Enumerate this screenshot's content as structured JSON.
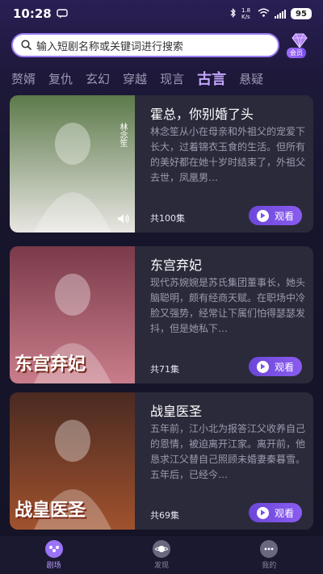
{
  "status_bar": {
    "time": "10:28",
    "network_speed": "1.8 K/s",
    "battery": "95"
  },
  "search": {
    "placeholder": "输入短剧名称或关键词进行搜索",
    "vip_label": "会员"
  },
  "tabs": [
    {
      "label": "赘婿",
      "active": false
    },
    {
      "label": "复仇",
      "active": false
    },
    {
      "label": "玄幻",
      "active": false
    },
    {
      "label": "穿越",
      "active": false
    },
    {
      "label": "现言",
      "active": false
    },
    {
      "label": "古言",
      "active": true
    },
    {
      "label": "悬疑",
      "active": false
    }
  ],
  "dramas": [
    {
      "title": "霍总，你别婚了头",
      "description": "林念笙从小在母亲和外祖父的宠爱下长大，过着锦衣玉食的生活。但所有的美好都在她十岁时结束了，外祖父去世，凤凰男…",
      "episodes": "共100集",
      "watch_label": "观看",
      "cover_caption": "林念笙",
      "cover_colors": [
        "#5c7a4a",
        "#e8e6e2"
      ]
    },
    {
      "title": "东宫弃妃",
      "description": "现代苏婉婉是苏氏集团董事长，她头脑聪明，颇有经商天赋。在职场中冷脸又强势，经常让下属们怕得瑟瑟发抖，但是她私下…",
      "episodes": "共71集",
      "watch_label": "观看",
      "cover_caption": "东宫弃妃",
      "cover_colors": [
        "#7a3a4a",
        "#c97d8a"
      ]
    },
    {
      "title": "战皇医圣",
      "description": "五年前，江小北为报答江父收养自己的恩情，被迫离开江家。离开前，他恳求江父替自己照顾未婚妻秦暮雪。五年后，已经今…",
      "episodes": "共69集",
      "watch_label": "观看",
      "cover_caption": "战皇医圣",
      "cover_colors": [
        "#4a2a22",
        "#a0522d"
      ]
    }
  ],
  "bottom_nav": [
    {
      "label": "剧场",
      "active": true,
      "icon": "theater-icon"
    },
    {
      "label": "发现",
      "active": false,
      "icon": "planet-icon"
    },
    {
      "label": "我的",
      "active": false,
      "icon": "profile-icon"
    }
  ],
  "colors": {
    "accent": "#8a5cf0",
    "tab_active": "#c3a8ff",
    "card_bg": "#2b2a3a"
  }
}
